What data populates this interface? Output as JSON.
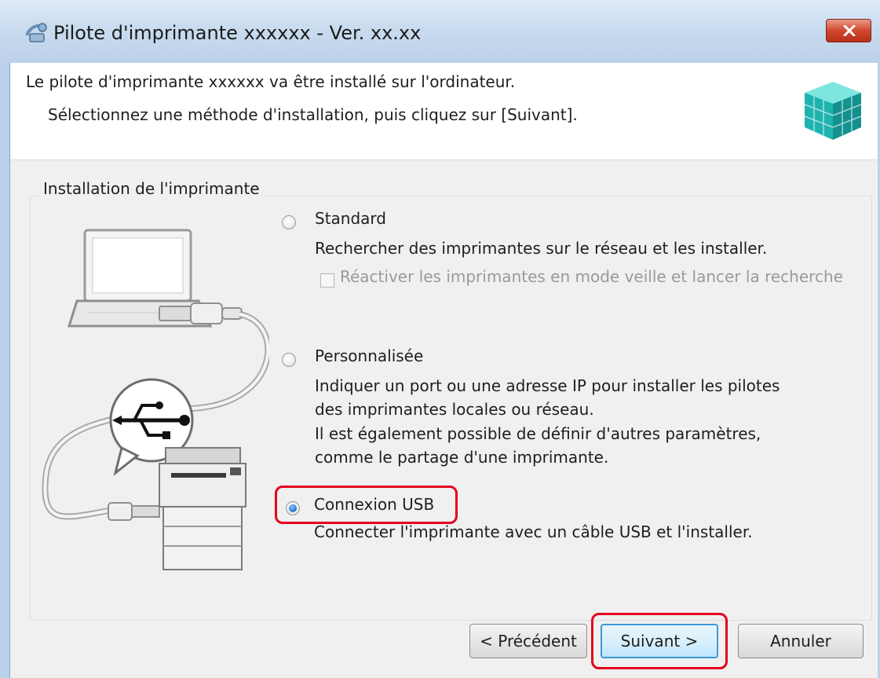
{
  "window": {
    "title": "Pilote d'imprimante xxxxxx - Ver. xx.xx",
    "close_icon": "close-icon"
  },
  "header": {
    "line1": "Le pilote d'imprimante xxxxxx va être installé sur l'ordinateur.",
    "line2": "Sélectionnez une méthode d'installation, puis cliquez sur [Suivant]."
  },
  "group": {
    "label": "Installation de l'imprimante"
  },
  "options": {
    "standard": {
      "label": "Standard",
      "checked": false,
      "desc": "Rechercher des imprimantes sur le réseau et les installer.",
      "sub_checkbox": {
        "label": "Réactiver les imprimantes en mode veille et lancer la recherche",
        "checked": false,
        "enabled": false
      }
    },
    "custom": {
      "label": "Personnalisée",
      "checked": false,
      "desc_lines": [
        "Indiquer un port ou une adresse IP pour installer les pilotes",
        "des imprimantes locales ou réseau.",
        "Il est également possible de définir d'autres paramètres,",
        "comme le partage d'une imprimante."
      ]
    },
    "usb": {
      "label": "Connexion USB",
      "checked": true,
      "desc": "Connecter l'imprimante avec un câble USB et l'installer."
    }
  },
  "buttons": {
    "back": "< Précédent",
    "next": "Suivant >",
    "cancel": "Annuler"
  },
  "colors": {
    "highlight": "#e6001e",
    "accent": "#3c9ad6"
  }
}
